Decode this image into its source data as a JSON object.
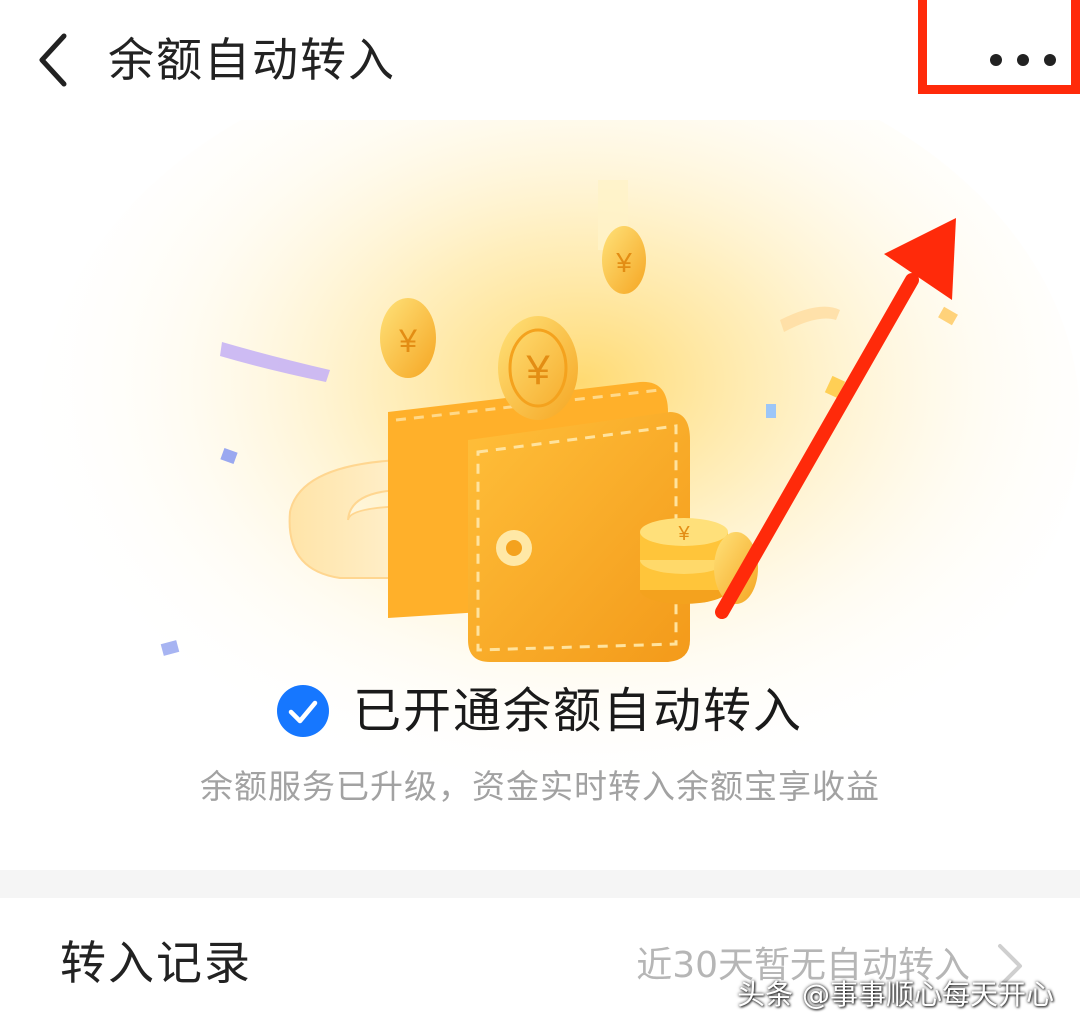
{
  "header": {
    "title": "余额自动转入",
    "back_icon": "chevron-left-icon",
    "more_icon": "more-horizontal-icon"
  },
  "hero": {
    "coin_symbol": "¥"
  },
  "status": {
    "title": "已开通余额自动转入",
    "subtitle": "余额服务已升级，资金实时转入余额宝享收益",
    "check_color": "#1677ff"
  },
  "record": {
    "label": "转入记录",
    "value": "近30天暂无自动转入"
  },
  "watermark": "头条 @事事顺心每天开心",
  "colors": {
    "highlight": "#ff2a0a",
    "wallet": "#fbb02a",
    "coin": "#ffc93a"
  }
}
